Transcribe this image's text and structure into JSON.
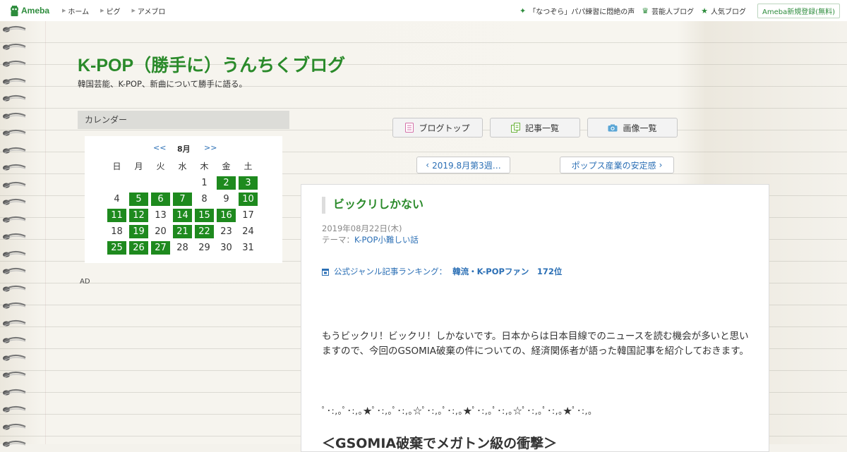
{
  "topbar": {
    "logo_text": "Ameba",
    "nav": [
      "ホーム",
      "ピグ",
      "アメブロ"
    ],
    "right_links": [
      {
        "icon": "sparkle-icon",
        "label": "「なつぞら」パパ練習に悶絶の声"
      },
      {
        "icon": "crown-icon",
        "label": "芸能人ブログ"
      },
      {
        "icon": "star-icon",
        "label": "人気ブログ"
      }
    ],
    "register_label": "Ameba新規登録(無料)"
  },
  "blog": {
    "title": "K-POP（勝手に）うんちくブログ",
    "description": "韓国芸能、K-POP、新曲について勝手に語る。"
  },
  "calendar": {
    "header": "カレンダー",
    "prev": "<<",
    "month": "8月",
    "next": ">>",
    "weekdays": [
      "日",
      "月",
      "火",
      "水",
      "木",
      "金",
      "土"
    ],
    "weeks": [
      [
        null,
        null,
        null,
        null,
        1,
        2,
        3
      ],
      [
        4,
        5,
        6,
        7,
        8,
        9,
        10
      ],
      [
        11,
        12,
        13,
        14,
        15,
        16,
        17
      ],
      [
        18,
        19,
        20,
        21,
        22,
        23,
        24
      ],
      [
        25,
        26,
        27,
        28,
        29,
        30,
        31
      ]
    ],
    "posted_days": [
      2,
      3,
      5,
      6,
      7,
      10,
      11,
      12,
      14,
      15,
      16,
      19,
      21,
      22,
      25,
      26,
      27
    ],
    "highlight_color": "#1e8a1e"
  },
  "ad_label": "AD",
  "buttons": {
    "blog_top": "ブログトップ",
    "article_list": "記事一覧",
    "image_list": "画像一覧"
  },
  "pager": {
    "prev_label": "2019.8月第3週…",
    "next_label": "ポップス産業の安定感"
  },
  "entry": {
    "title": "ビックリしかない",
    "date": "2019年08月22日(木)",
    "theme_prefix": "テーマ：",
    "theme": "K-POP小難しい話",
    "ranking_label": "公式ジャンル記事ランキング：",
    "ranking_value": "韓流・K-POPファン　172位",
    "body": "もうビックリ！ビックリ！しかないです。日本からは日本目線でのニュースを読む機会が多いと思いますので、今回のGSOMIA破棄の件についての、経済関係者が語った韓国記事を紹介しておきます。",
    "decoration": "ﾟ･:,｡ﾟ･:,｡★ﾟ･:,｡ﾟ･:,｡☆ﾟ･:,｡ﾟ･:,｡★ﾟ･:,｡ﾟ･:,｡☆ﾟ･:,｡ﾟ･:,｡★ﾟ･:,｡",
    "subheading": "＜GSOMIA破棄でメガトン級の衝撃＞"
  },
  "colors": {
    "brand_green": "#2a8a2a",
    "link_blue": "#2b6fb5"
  }
}
